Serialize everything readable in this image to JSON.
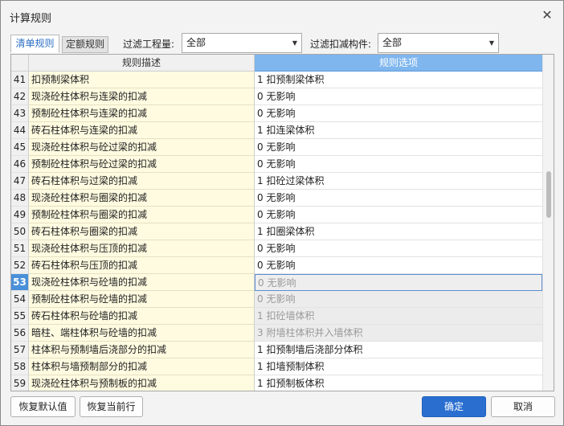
{
  "window": {
    "title": "计算规则"
  },
  "tabs": {
    "active": "清单规则",
    "inactive": "定额规则"
  },
  "filters": {
    "quantity_label": "过滤工程量:",
    "quantity_value": "全部",
    "component_label": "过滤扣减构件:",
    "component_value": "全部"
  },
  "table": {
    "headers": {
      "desc": "规则描述",
      "option": "规则选项"
    },
    "rows": [
      {
        "num": "41",
        "desc": "扣预制梁体积",
        "option": "1  扣预制梁体积",
        "state": "normal"
      },
      {
        "num": "42",
        "desc": "现浇砼柱体积与连梁的扣减",
        "option": "0  无影响",
        "state": "normal"
      },
      {
        "num": "43",
        "desc": "预制砼柱体积与连梁的扣减",
        "option": "0  无影响",
        "state": "normal"
      },
      {
        "num": "44",
        "desc": "砖石柱体积与连梁的扣减",
        "option": "1 扣连梁体积",
        "state": "normal"
      },
      {
        "num": "45",
        "desc": "现浇砼柱体积与砼过梁的扣减",
        "option": "0  无影响",
        "state": "normal"
      },
      {
        "num": "46",
        "desc": "预制砼柱体积与砼过梁的扣减",
        "option": "0  无影响",
        "state": "normal"
      },
      {
        "num": "47",
        "desc": "砖石柱体积与过梁的扣减",
        "option": "1 扣砼过梁体积",
        "state": "normal"
      },
      {
        "num": "48",
        "desc": "现浇砼柱体积与圈梁的扣减",
        "option": "0  无影响",
        "state": "normal"
      },
      {
        "num": "49",
        "desc": "预制砼柱体积与圈梁的扣减",
        "option": "0  无影响",
        "state": "normal"
      },
      {
        "num": "50",
        "desc": "砖石柱体积与圈梁的扣减",
        "option": "1 扣圈梁体积",
        "state": "normal"
      },
      {
        "num": "51",
        "desc": "现浇砼柱体积与压顶的扣减",
        "option": "0  无影响",
        "state": "normal"
      },
      {
        "num": "52",
        "desc": "砖石柱体积与压顶的扣减",
        "option": "0  无影响",
        "state": "normal"
      },
      {
        "num": "53",
        "desc": "现浇砼柱体积与砼墙的扣减",
        "option": "0  无影响",
        "state": "focused"
      },
      {
        "num": "54",
        "desc": "预制砼柱体积与砼墙的扣减",
        "option": "0  无影响",
        "state": "disabled"
      },
      {
        "num": "55",
        "desc": "砖石柱体积与砼墙的扣减",
        "option": "1 扣砼墙体积",
        "state": "disabled"
      },
      {
        "num": "56",
        "desc": "暗柱、端柱体积与砼墙的扣减",
        "option": "3 附墙柱体积并入墙体积",
        "state": "disabled"
      },
      {
        "num": "57",
        "desc": "柱体积与预制墙后浇部分的扣减",
        "option": "1 扣预制墙后浇部分体积",
        "state": "normal"
      },
      {
        "num": "58",
        "desc": "柱体积与墙预制部分的扣减",
        "option": "1 扣墙预制体积",
        "state": "normal"
      },
      {
        "num": "59",
        "desc": "现浇砼柱体积与预制板的扣减",
        "option": "1 扣预制板体积",
        "state": "normal"
      }
    ]
  },
  "buttons": {
    "restore_default": "恢复默认值",
    "restore_row": "恢复当前行",
    "ok": "确定",
    "cancel": "取消"
  },
  "icons": {
    "close": "close-icon",
    "dropdown": "chevron-down-icon"
  }
}
